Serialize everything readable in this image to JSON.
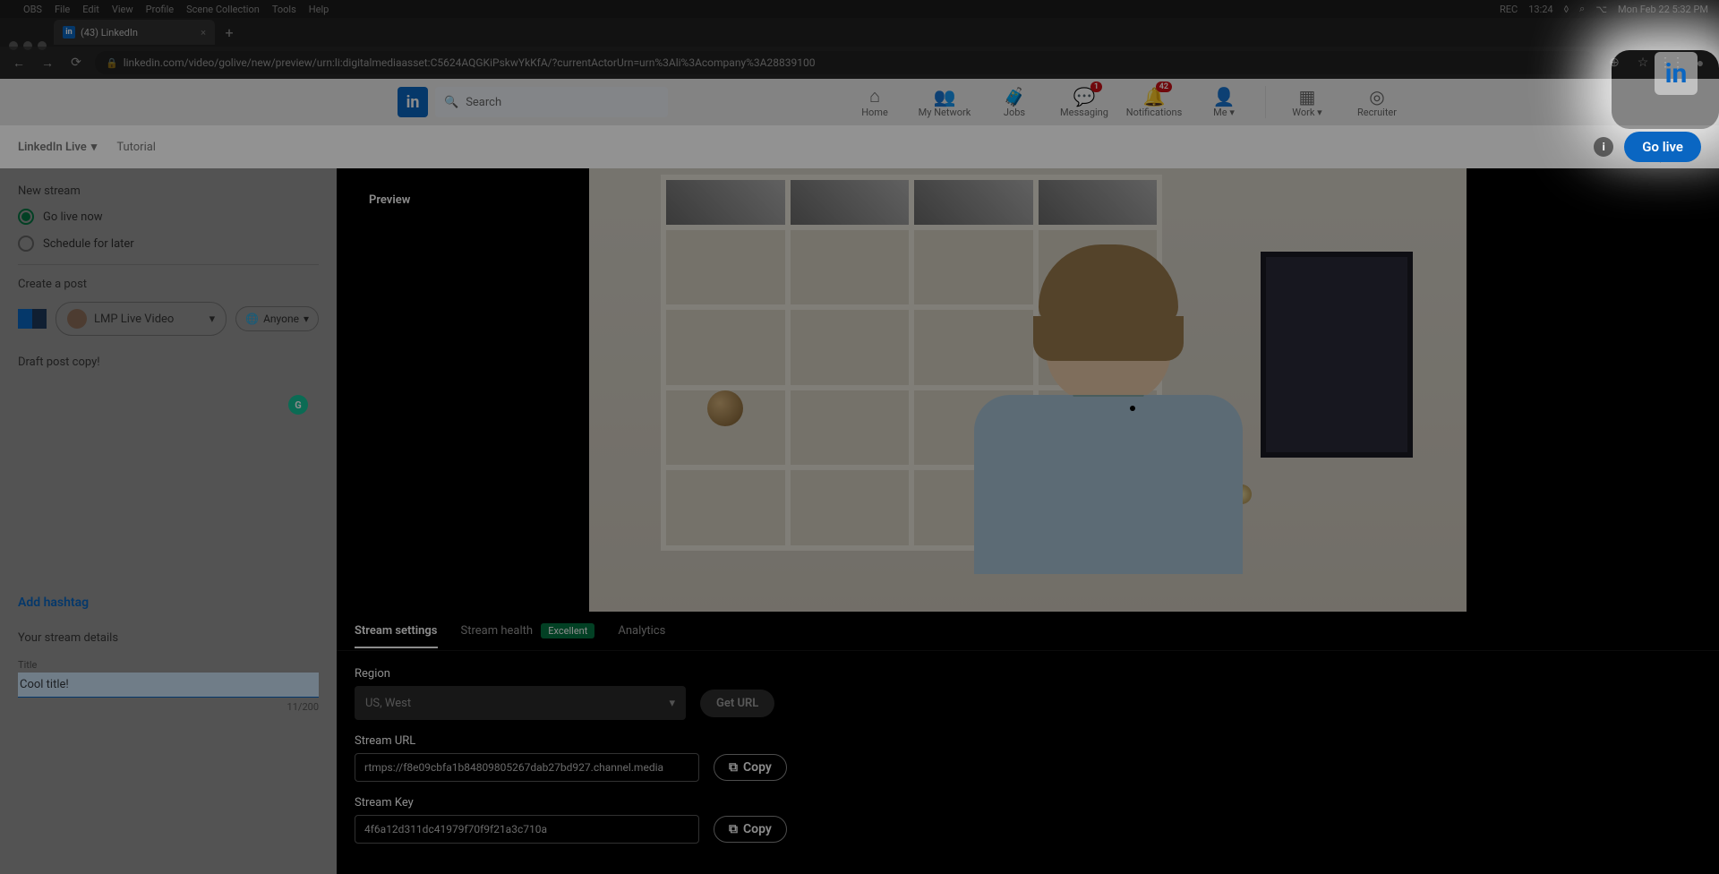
{
  "mac": {
    "menus": [
      "OBS",
      "File",
      "Edit",
      "View",
      "Profile",
      "Scene Collection",
      "Tools",
      "Help"
    ],
    "status_right": [
      "REC",
      "13:24",
      "Mon Feb 22  5:32 PM"
    ]
  },
  "browser": {
    "tab": {
      "title": "(43) LinkedIn"
    },
    "url": "linkedin.com/video/golive/new/preview/urn:li:digitalmediaasset:C5624AQGKiPskwYkKfA/?currentActorUrn=urn%3Ali%3Acompany%3A28839100"
  },
  "linkedin_nav": {
    "search_placeholder": "Search",
    "items": [
      {
        "label": "Home"
      },
      {
        "label": "My Network"
      },
      {
        "label": "Jobs"
      },
      {
        "label": "Messaging",
        "badge": "1"
      },
      {
        "label": "Notifications",
        "badge": "42"
      },
      {
        "label": "Me ▾"
      },
      {
        "label": "Work ▾"
      },
      {
        "label": "Recruiter"
      }
    ]
  },
  "subbar": {
    "brand": "LinkedIn Live",
    "tutorial": "Tutorial",
    "go_live": "Go live"
  },
  "sidebar": {
    "new_stream": "New stream",
    "opt_now": "Go live now",
    "opt_later": "Schedule for later",
    "create_post": "Create a post",
    "page_name": "LMP Live Video",
    "anyone": "Anyone",
    "draft_text": "Draft post copy!",
    "add_hashtag": "Add hashtag",
    "details_header": "Your stream details",
    "title_label": "Title",
    "title_value": "Cool title!",
    "char_count": "11/200"
  },
  "preview": {
    "label": "Preview"
  },
  "tabs": {
    "settings": "Stream settings",
    "health": "Stream health",
    "excellent": "Excellent",
    "analytics": "Analytics"
  },
  "settings": {
    "region_label": "Region",
    "region_value": "US, West",
    "get_url": "Get URL",
    "url_label": "Stream URL",
    "url_value": "rtmps://f8e09cbfa1b84809805267dab27bd927.channel.media",
    "key_label": "Stream Key",
    "key_value": "4f6a12d311dc41979f70f9f21a3c710a",
    "copy": "Copy"
  }
}
